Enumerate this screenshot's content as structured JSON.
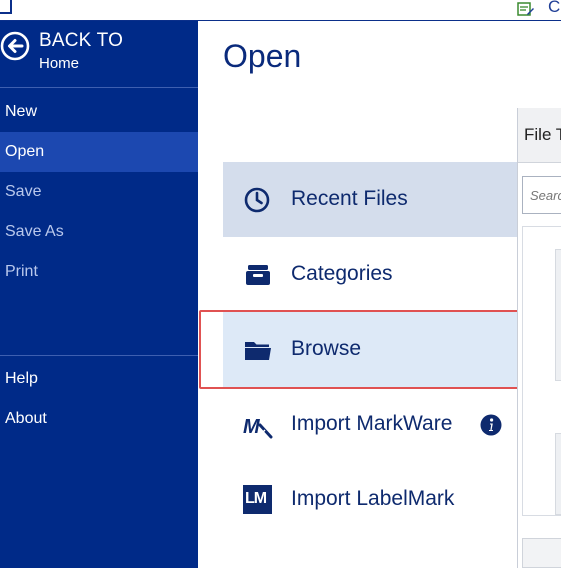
{
  "header": {
    "partial_right_text": "C"
  },
  "sidebar": {
    "back": {
      "title": "BACK TO",
      "subtitle": "Home"
    },
    "items": [
      {
        "label": "New"
      },
      {
        "label": "Open"
      },
      {
        "label": "Save"
      },
      {
        "label": "Save As"
      },
      {
        "label": "Print"
      },
      {
        "label": "Help"
      },
      {
        "label": "About"
      }
    ],
    "active_item": "Open"
  },
  "main": {
    "title": "Open",
    "options": [
      {
        "label": "Recent Files",
        "icon": "clock-icon"
      },
      {
        "label": "Categories",
        "icon": "archive-box-icon"
      },
      {
        "label": "Browse",
        "icon": "folder-icon"
      },
      {
        "label": "Import MarkWare",
        "icon": "markware-icon"
      },
      {
        "label": "Import LabelMark",
        "icon": "labelmark-icon",
        "icon_text": "LM"
      }
    ],
    "selected_option": "Recent Files",
    "highlighted_option": "Browse"
  },
  "right_panel": {
    "header": "File T",
    "search_placeholder": "Search"
  },
  "colors": {
    "sidebar_bg": "#002a88",
    "sidebar_active": "#1c48b0",
    "accent": "#0a2a7c",
    "highlight_border": "#e05252"
  }
}
